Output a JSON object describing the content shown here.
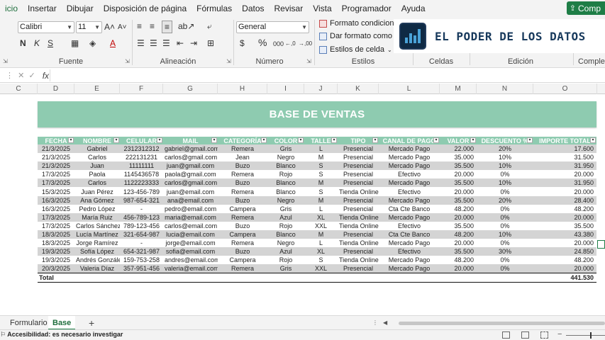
{
  "menu": {
    "items": [
      "icio",
      "Insertar",
      "Dibujar",
      "Disposición de página",
      "Fórmulas",
      "Datos",
      "Revisar",
      "Vista",
      "Programador",
      "Ayuda"
    ],
    "share_label": "Comp"
  },
  "ribbon": {
    "font_name": "Calibri",
    "font_size": "11",
    "number_format": "General",
    "groups": {
      "font": "Fuente",
      "alignment": "Alineación",
      "number": "Número",
      "styles": "Estilos",
      "cells": "Celdas",
      "editing": "Edición",
      "addins": "Compleme"
    },
    "styles": {
      "conditional": "Formato condiciona",
      "as_table": "Dar formato como",
      "cell_styles": "Estilos de celda"
    },
    "font_buttons": {
      "bold": "N",
      "italic": "K",
      "underline": "S",
      "grow": "A",
      "shrink": "A"
    },
    "number_buttons": {
      "currency": "$",
      "percent": "%",
      "thousands": "000",
      "inc_dec": "←,0",
      "dec_dec": "→,00"
    }
  },
  "brand": {
    "title": "EL PODER DE LOS DATOS",
    "accent_color": "#4aa3d8",
    "bg_color": "#0f2a44"
  },
  "formula_bar": {
    "fx": "fx"
  },
  "columns": [
    "C",
    "D",
    "E",
    "F",
    "G",
    "H",
    "I",
    "J",
    "K",
    "L",
    "M",
    "N",
    "O"
  ],
  "sheet": {
    "title": "BASE DE VENTAS",
    "title_color": "#8ecbb0",
    "table": {
      "headers": [
        "FECHA",
        "NOMBRE",
        "CELULAR",
        "MAIL",
        "CATEGORÍA",
        "COLOR",
        "TALLE",
        "TIPO",
        "CANAL DE PAGO",
        "VALOR",
        "DESCUENTO %",
        "IMPORTE TOTAL"
      ],
      "rows": [
        [
          "21/3/2025",
          "Gabriel",
          "2312312312",
          "gabriel@gmail.com",
          "Remera",
          "Gris",
          "L",
          "Presencial",
          "Mercado Pago",
          "22.000",
          "20%",
          "17.600"
        ],
        [
          "21/3/2025",
          "Carlos",
          "222131231",
          "carlos@gmail.com",
          "Jean",
          "Negro",
          "M",
          "Presencial",
          "Mercado Pago",
          "35.000",
          "10%",
          "31.500"
        ],
        [
          "21/3/2025",
          "Juan",
          "11111111",
          "juan@gmail.com",
          "Buzo",
          "Blanco",
          "S",
          "Presencial",
          "Mercado Pago",
          "35.500",
          "10%",
          "31.950"
        ],
        [
          "17/3/2025",
          "Paola",
          "1145436578",
          "paola@gmail.com",
          "Remera",
          "Rojo",
          "S",
          "Presencial",
          "Efectivo",
          "20.000",
          "0%",
          "20.000"
        ],
        [
          "17/3/2025",
          "Carlos",
          "1122223333",
          "carlos@gmail.com",
          "Buzo",
          "Blanco",
          "M",
          "Presencial",
          "Mercado Pago",
          "35.500",
          "10%",
          "31.950"
        ],
        [
          "15/3/2025",
          "Juan Pérez",
          "123-456-789",
          "juan@email.com",
          "Remera",
          "Blanco",
          "S",
          "Tienda Online",
          "Efectivo",
          "20.000",
          "0%",
          "20.000"
        ],
        [
          "16/3/2025",
          "Ana Gómez",
          "987-654-321",
          "ana@email.com",
          "Buzo",
          "Negro",
          "M",
          "Presencial",
          "Mercado Pago",
          "35.500",
          "20%",
          "28.400"
        ],
        [
          "16/3/2025",
          "Pedro López",
          "-",
          "pedro@email.com",
          "Campera",
          "Gris",
          "L",
          "Presencial",
          "Cta Cte Banco",
          "48.200",
          "0%",
          "48.200"
        ],
        [
          "17/3/2025",
          "María Ruiz",
          "456-789-123",
          "maria@email.com",
          "Remera",
          "Azul",
          "XL",
          "Tienda Online",
          "Mercado Pago",
          "20.000",
          "0%",
          "20.000"
        ],
        [
          "17/3/2025",
          "Carlos Sánchez",
          "789-123-456",
          "carlos@email.com",
          "Buzo",
          "Rojo",
          "XXL",
          "Tienda Online",
          "Efectivo",
          "35.500",
          "0%",
          "35.500"
        ],
        [
          "18/3/2025",
          "Lucía Martínez",
          "321-654-987",
          "lucia@email.com",
          "Campera",
          "Blanco",
          "M",
          "Presencial",
          "Cta Cte Banco",
          "48.200",
          "10%",
          "43.380"
        ],
        [
          "18/3/2025",
          "Jorge Ramírez",
          "-",
          "jorge@email.com",
          "Remera",
          "Negro",
          "L",
          "Tienda Online",
          "Mercado Pago",
          "20.000",
          "0%",
          "20.000"
        ],
        [
          "19/3/2025",
          "Sofía López",
          "654-321-987",
          "sofia@email.com",
          "Buzo",
          "Azul",
          "XL",
          "Presencial",
          "Efectivo",
          "35.500",
          "30%",
          "24.850"
        ],
        [
          "19/3/2025",
          "Andrés González",
          "159-753-258",
          "andres@email.com",
          "Campera",
          "Rojo",
          "S",
          "Tienda Online",
          "Mercado Pago",
          "48.200",
          "0%",
          "48.200"
        ],
        [
          "20/3/2025",
          "Valeria Díaz",
          "357-951-456",
          "valeria@email.com",
          "Remera",
          "Gris",
          "XXL",
          "Presencial",
          "Mercado Pago",
          "20.000",
          "0%",
          "20.000"
        ]
      ],
      "total_label": "Total",
      "total_value": "441.530"
    }
  },
  "tabs": {
    "items": [
      "Formulario",
      "Base"
    ],
    "active": "Base",
    "add_label": "+"
  },
  "status": {
    "accessibility": "Accesibilidad: es necesario investigar"
  }
}
